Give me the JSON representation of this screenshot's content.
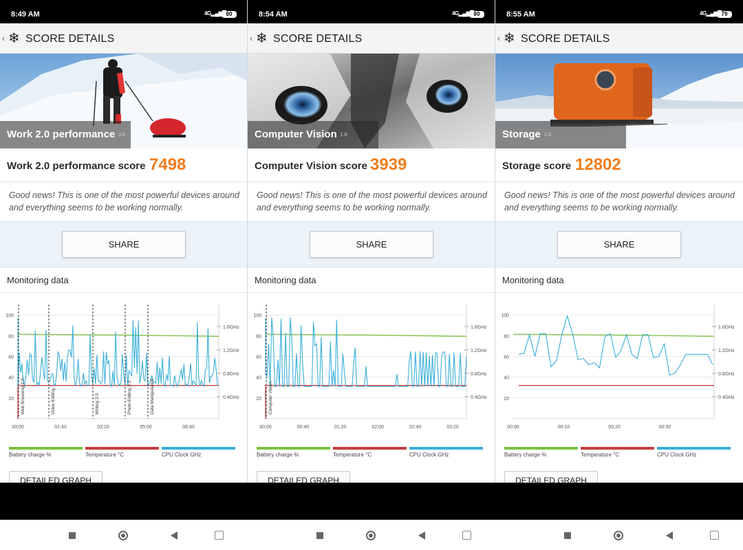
{
  "screens": [
    {
      "time": "8:49 AM",
      "signal": "4G",
      "battery": "80",
      "title": "SCORE DETAILS",
      "hero_caption": "Work 2.0 performance",
      "hero_version": "2.0",
      "score_label": "Work 2.0 performance score",
      "score_value": "7498",
      "description": "Good news! This is one of the most powerful devices around and everything seems to be working normally.",
      "share": "SHARE",
      "monitoring_title": "Monitoring data",
      "legend": [
        "Battery charge %",
        "Temperature °C",
        "CPU Clock GHz"
      ],
      "detail_button": "DETAILED GRAPH",
      "chart_data": {
        "type": "line",
        "y_left_ticks": [
          "100",
          "80",
          "60",
          "40",
          "20"
        ],
        "y_right_ticks": [
          "1.6GHz",
          "1.2GHz",
          "0.8GHz",
          "0.4GHz"
        ],
        "x_ticks": [
          "00:00",
          "01:40",
          "03:20",
          "05:00",
          "06:40"
        ],
        "annotations": [
          "Web Browsing 2.0",
          "Video Editing",
          "Writing 2.0",
          "Photo Editing 2.0",
          "Data Manipulation"
        ],
        "battery_level": 80,
        "temperature_level": 32
      }
    },
    {
      "time": "8:54 AM",
      "signal": "4G",
      "battery": "80",
      "title": "SCORE DETAILS",
      "hero_caption": "Computer Vision",
      "hero_version": "1.0",
      "score_label": "Computer Vision score",
      "score_value": "3939",
      "description": "Good news! This is one of the most powerful devices around and everything seems to be working normally.",
      "share": "SHARE",
      "monitoring_title": "Monitoring data",
      "legend": [
        "Battery charge %",
        "Temperature °C",
        "CPU Clock GHz"
      ],
      "detail_button": "DETAILED GRAPH",
      "chart_data": {
        "type": "line",
        "y_left_ticks": [
          "100",
          "80",
          "60",
          "40",
          "20"
        ],
        "y_right_ticks": [
          "1.6GHz",
          "1.2GHz",
          "0.8GHz",
          "0.4GHz"
        ],
        "x_ticks": [
          "00:00",
          "00:40",
          "01:20",
          "02:00",
          "02:40",
          "03:20"
        ],
        "annotations": [
          "Computer Vision"
        ],
        "battery_level": 80,
        "temperature_level": 32
      }
    },
    {
      "time": "8:55 AM",
      "signal": "4G",
      "battery": "79",
      "title": "SCORE DETAILS",
      "hero_caption": "Storage",
      "hero_version": "1.0",
      "score_label": "Storage score",
      "score_value": "12802",
      "description": "Good news! This is one of the most powerful devices around and everything seems to be working normally.",
      "share": "SHARE",
      "monitoring_title": "Monitoring data",
      "legend": [
        "Battery charge %",
        "Temperature °C",
        "CPU Clock GHz"
      ],
      "detail_button": "DETAILED GRAPH",
      "chart_data": {
        "type": "line",
        "y_left_ticks": [
          "100",
          "80",
          "60",
          "40",
          "20"
        ],
        "y_right_ticks": [
          "1.6GHz",
          "1.2GHz",
          "0.8GHz",
          "0.4GHz"
        ],
        "x_ticks": [
          "00:00",
          "00:10",
          "00:20",
          "00:30"
        ],
        "annotations": [],
        "battery_level": 80,
        "temperature_level": 32
      }
    }
  ],
  "colors": {
    "score": "#f07d1d",
    "battery": "#7cc242",
    "temperature": "#c63c3c",
    "cpu": "#3aafd9"
  }
}
